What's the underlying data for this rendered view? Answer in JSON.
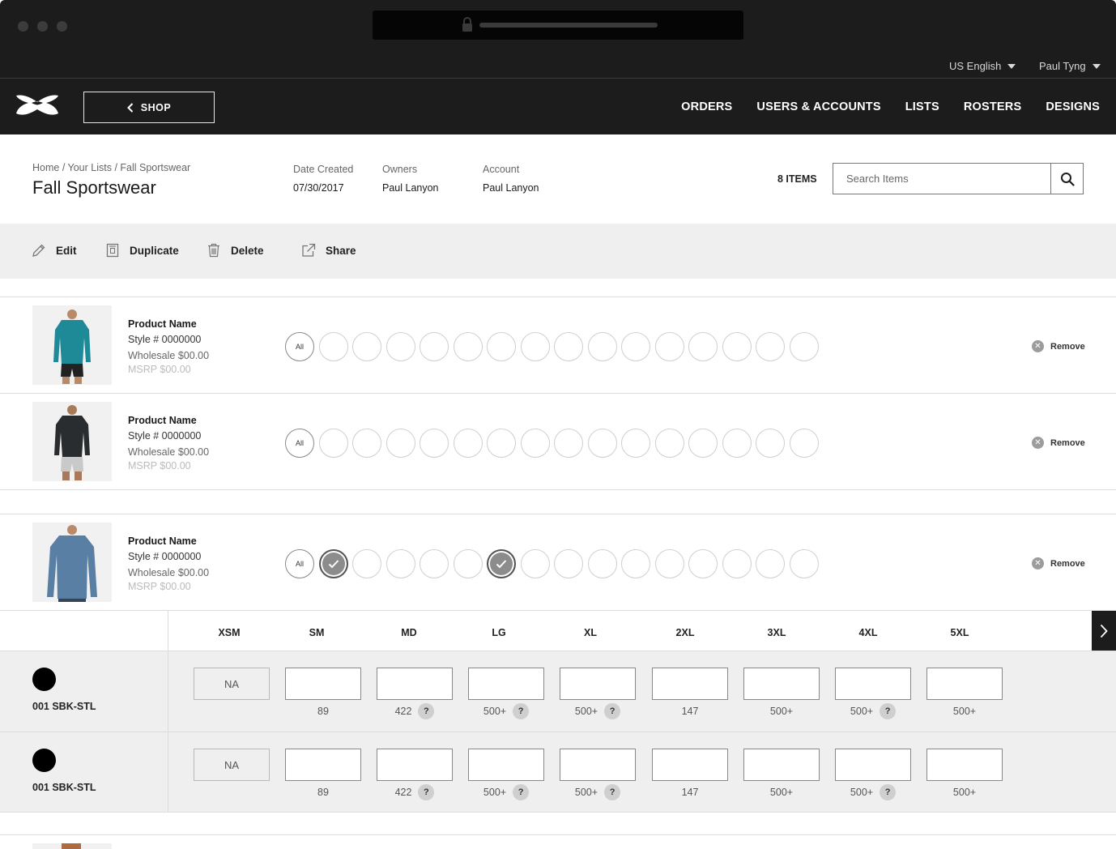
{
  "topbar": {
    "language": "US English",
    "user": "Paul Tyng"
  },
  "nav": {
    "shop_label": "SHOP",
    "links": [
      "ORDERS",
      "USERS & ACCOUNTS",
      "LISTS",
      "ROSTERS",
      "DESIGNS"
    ]
  },
  "header": {
    "breadcrumb": "Home / Your Lists / Fall Sportswear",
    "title": "Fall Sportswear",
    "meta": [
      {
        "label": "Date Created",
        "value": "07/30/2017"
      },
      {
        "label": "Owners",
        "value": "Paul Lanyon"
      },
      {
        "label": "Account",
        "value": "Paul Lanyon"
      }
    ],
    "items_count": "8 ITEMS",
    "search_placeholder": "Search Items"
  },
  "toolbar": {
    "edit": "Edit",
    "duplicate": "Duplicate",
    "delete": "Delete",
    "share": "Share"
  },
  "products": [
    {
      "name": "Product Name",
      "style": "Style # 0000000",
      "wholesale": "Wholesale $00.00",
      "msrp": "MSRP $00.00",
      "all_label": "All",
      "remove_label": "Remove",
      "shirt_color": "#1e8a98",
      "pants_color": "#222222",
      "selected_swatches": []
    },
    {
      "name": "Product Name",
      "style": "Style # 0000000",
      "wholesale": "Wholesale $00.00",
      "msrp": "MSRP $00.00",
      "all_label": "All",
      "remove_label": "Remove",
      "shirt_color": "#2a2d2f",
      "pants_color": "#c9c9c9",
      "selected_swatches": []
    },
    {
      "name": "Product Name",
      "style": "Style # 0000000",
      "wholesale": "Wholesale $00.00",
      "msrp": "MSRP $00.00",
      "all_label": "All",
      "remove_label": "Remove",
      "shirt_color": "#5a7fa4",
      "pants_color": "#3a4450",
      "selected_swatches": [
        1,
        6
      ]
    }
  ],
  "sizes": [
    "XSM",
    "SM",
    "MD",
    "LG",
    "XL",
    "2XL",
    "3XL",
    "4XL",
    "5XL"
  ],
  "color_rows": [
    {
      "code": "001 SBK-STL",
      "swatch_color": "#000000",
      "cells": [
        {
          "value": "NA",
          "na": true,
          "stock": "",
          "help": false
        },
        {
          "value": "",
          "na": false,
          "stock": "89",
          "help": false
        },
        {
          "value": "",
          "na": false,
          "stock": "422",
          "help": true
        },
        {
          "value": "",
          "na": false,
          "stock": "500+",
          "help": true
        },
        {
          "value": "",
          "na": false,
          "stock": "500+",
          "help": true
        },
        {
          "value": "",
          "na": false,
          "stock": "147",
          "help": false
        },
        {
          "value": "",
          "na": false,
          "stock": "500+",
          "help": false
        },
        {
          "value": "",
          "na": false,
          "stock": "500+",
          "help": true
        },
        {
          "value": "",
          "na": false,
          "stock": "500+",
          "help": false
        }
      ]
    },
    {
      "code": "001 SBK-STL",
      "swatch_color": "#000000",
      "cells": [
        {
          "value": "NA",
          "na": true,
          "stock": "",
          "help": false
        },
        {
          "value": "",
          "na": false,
          "stock": "89",
          "help": false
        },
        {
          "value": "",
          "na": false,
          "stock": "422",
          "help": true
        },
        {
          "value": "",
          "na": false,
          "stock": "500+",
          "help": true
        },
        {
          "value": "",
          "na": false,
          "stock": "500+",
          "help": true
        },
        {
          "value": "",
          "na": false,
          "stock": "147",
          "help": false
        },
        {
          "value": "",
          "na": false,
          "stock": "500+",
          "help": false
        },
        {
          "value": "",
          "na": false,
          "stock": "500+",
          "help": true
        },
        {
          "value": "",
          "na": false,
          "stock": "500+",
          "help": false
        }
      ]
    }
  ],
  "help_glyph": "?",
  "colors": {
    "dark": "#1c1c1c",
    "panel": "#efefef",
    "accent": "#8c8c8c"
  }
}
